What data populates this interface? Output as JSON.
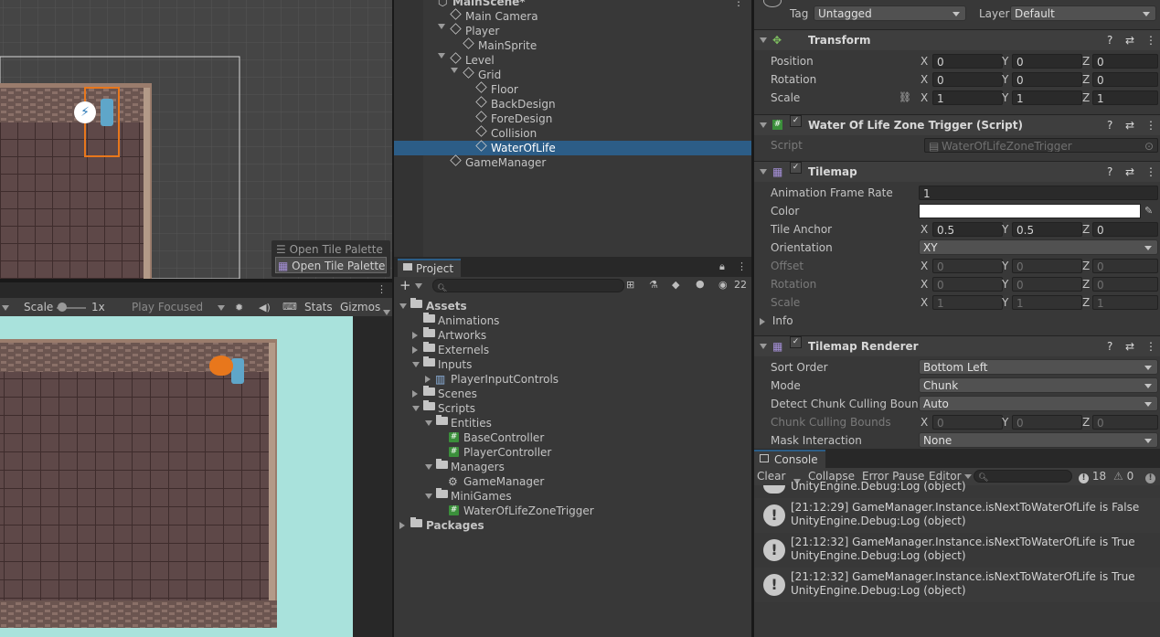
{
  "scene_view": {
    "open_tile_palette_dim": "Open Tile Palette",
    "open_tile_palette": "Open Tile Palette"
  },
  "game_view": {
    "scale_label": "Scale",
    "scale_value": "1x",
    "play_mode": "Play Focused",
    "stats": "Stats",
    "gizmos": "Gizmos"
  },
  "hierarchy": {
    "items": [
      {
        "label": "MainScene*"
      },
      {
        "label": "Main Camera"
      },
      {
        "label": "Player"
      },
      {
        "label": "MainSprite"
      },
      {
        "label": "Level"
      },
      {
        "label": "Grid"
      },
      {
        "label": "Floor"
      },
      {
        "label": "BackDesign"
      },
      {
        "label": "ForeDesign"
      },
      {
        "label": "Collision"
      },
      {
        "label": "WaterOfLife"
      },
      {
        "label": "GameManager"
      }
    ]
  },
  "project": {
    "tab": "Project",
    "hidden_count": "22",
    "items": [
      {
        "label": "Assets"
      },
      {
        "label": "Animations"
      },
      {
        "label": "Artworks"
      },
      {
        "label": "Externels"
      },
      {
        "label": "Inputs"
      },
      {
        "label": "PlayerInputControls"
      },
      {
        "label": "Scenes"
      },
      {
        "label": "Scripts"
      },
      {
        "label": "Entities"
      },
      {
        "label": "BaseController"
      },
      {
        "label": "PlayerController"
      },
      {
        "label": "Managers"
      },
      {
        "label": "GameManager"
      },
      {
        "label": "MiniGames"
      },
      {
        "label": "WaterOfLifeZoneTrigger"
      },
      {
        "label": "Packages"
      }
    ]
  },
  "inspector": {
    "tag_label": "Tag",
    "tag_value": "Untagged",
    "layer_label": "Layer",
    "layer_value": "Default",
    "transform": {
      "title": "Transform",
      "position_label": "Position",
      "rotation_label": "Rotation",
      "scale_label": "Scale",
      "position": [
        "0",
        "0",
        "0"
      ],
      "rotation": [
        "0",
        "0",
        "0"
      ],
      "scale": [
        "1",
        "1",
        "1"
      ]
    },
    "script_comp": {
      "title": "Water Of Life Zone Trigger (Script)",
      "script_label": "Script",
      "script_value": "WaterOfLifeZoneTrigger"
    },
    "tilemap": {
      "title": "Tilemap",
      "anim_rate_label": "Animation Frame Rate",
      "anim_rate_value": "1",
      "color_label": "Color",
      "tile_anchor_label": "Tile Anchor",
      "tile_anchor": [
        "0.5",
        "0.5",
        "0"
      ],
      "orientation_label": "Orientation",
      "orientation_value": "XY",
      "offset_label": "Offset",
      "offset": [
        "0",
        "0",
        "0"
      ],
      "rotation_label": "Rotation",
      "rotation": [
        "0",
        "0",
        "0"
      ],
      "scale_label": "Scale",
      "scale": [
        "1",
        "1",
        "1"
      ],
      "info_label": "Info"
    },
    "renderer": {
      "title": "Tilemap Renderer",
      "sort_order_label": "Sort Order",
      "sort_order_value": "Bottom Left",
      "mode_label": "Mode",
      "mode_value": "Chunk",
      "detect_label": "Detect Chunk Culling Bound",
      "detect_value": "Auto",
      "bounds_label": "Chunk Culling Bounds",
      "bounds": [
        "0",
        "0",
        "0"
      ],
      "mask_label": "Mask Interaction",
      "mask_value": "None"
    },
    "axis_x": "X",
    "axis_y": "Y",
    "axis_z": "Z"
  },
  "console": {
    "tab": "Console",
    "clear": "Clear",
    "collapse": "Collapse",
    "error_pause": "Error Pause",
    "editor": "Editor",
    "log_count": "18",
    "warn_count": "0",
    "partial_line": "UnityEngine.Debug:Log (object)",
    "logs": [
      {
        "line1": "[21:12:29] GameManager.Instance.isNextToWaterOfLife is False",
        "line2": "UnityEngine.Debug:Log (object)"
      },
      {
        "line1": "[21:12:32] GameManager.Instance.isNextToWaterOfLife is True",
        "line2": "UnityEngine.Debug:Log (object)"
      },
      {
        "line1": "[21:12:32] GameManager.Instance.isNextToWaterOfLife is True",
        "line2": "UnityEngine.Debug:Log (object)"
      }
    ]
  },
  "colors": {
    "selection": "#2c5d87",
    "game_bg": "#a9e2dc",
    "floor": "#5e4848",
    "wall": "#8f7468",
    "highlight": "#e8771c"
  }
}
